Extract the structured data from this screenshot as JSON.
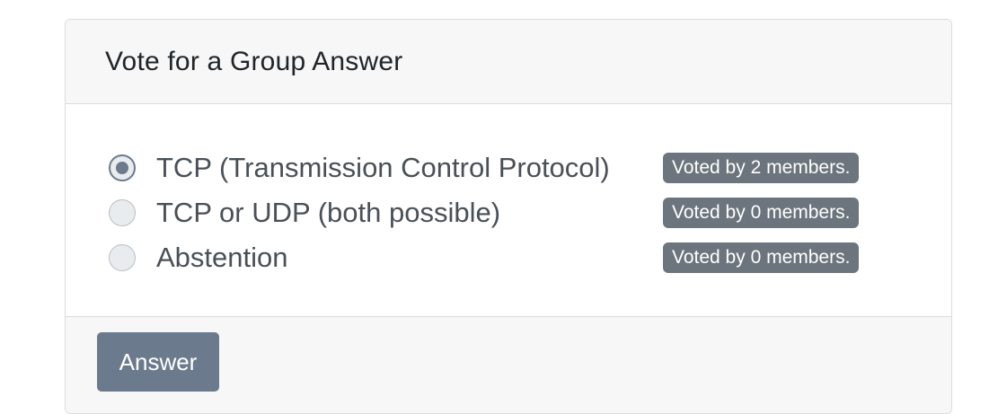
{
  "card": {
    "title": "Vote for a Group Answer"
  },
  "options": [
    {
      "label": "TCP (Transmission Control Protocol)",
      "badge": "Voted by 2 members.",
      "checked": true
    },
    {
      "label": "TCP or UDP (both possible)",
      "badge": "Voted by 0 members.",
      "checked": false
    },
    {
      "label": "Abstention",
      "badge": "Voted by 0 members.",
      "checked": false
    }
  ],
  "footer": {
    "answer_label": "Answer"
  },
  "colors": {
    "accent": "#6c7a8d",
    "badge_bg": "#6c757d",
    "header_bg": "#f7f7f7"
  }
}
